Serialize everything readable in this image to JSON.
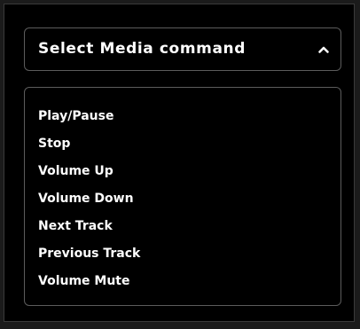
{
  "dropdown": {
    "title": "Select Media command",
    "expanded_icon": "chevron-up-icon",
    "items": [
      {
        "label": "Play/Pause"
      },
      {
        "label": "Stop"
      },
      {
        "label": "Volume Up"
      },
      {
        "label": "Volume Down"
      },
      {
        "label": "Next Track"
      },
      {
        "label": "Previous Track"
      },
      {
        "label": "Volume Mute"
      }
    ]
  },
  "colors": {
    "background": "#000000",
    "text": "#ffffff",
    "border": "#5c5c5c"
  }
}
